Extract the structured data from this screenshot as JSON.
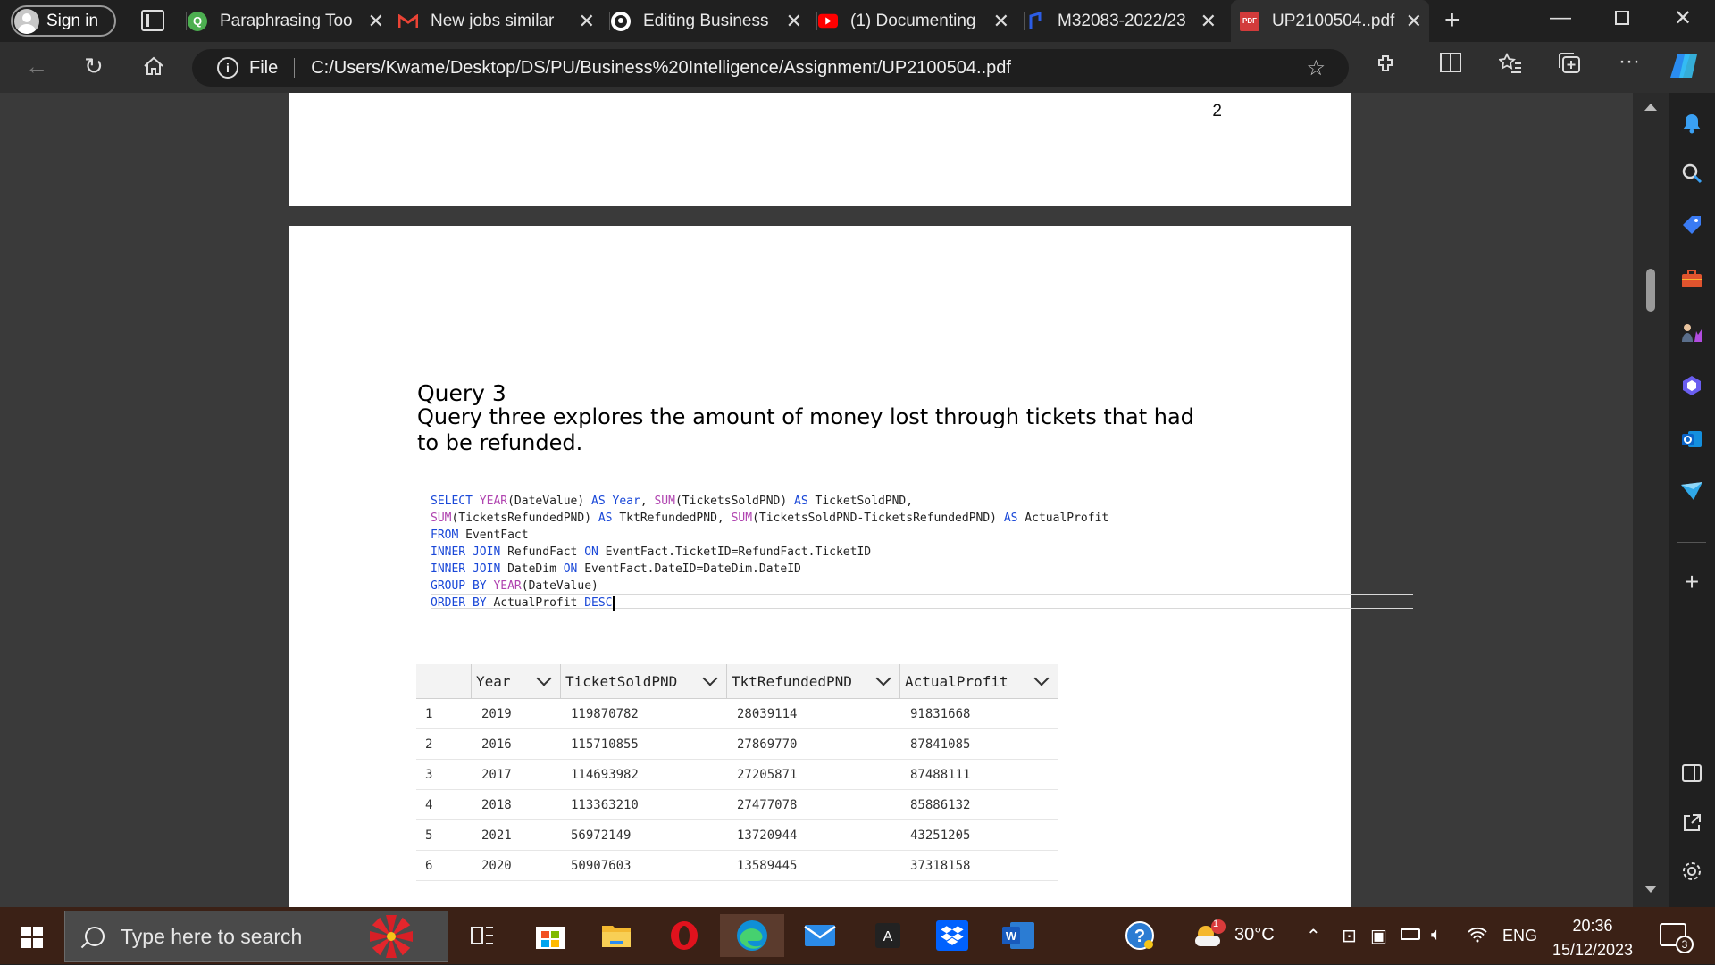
{
  "browser": {
    "profile_label": "Sign in",
    "tabs": [
      {
        "title": "Paraphrasing Too",
        "icon": "quillbot-icon",
        "closable": true
      },
      {
        "title": "New jobs similar",
        "icon": "gmail-icon",
        "closable": true
      },
      {
        "title": "Editing Business",
        "icon": "github-icon",
        "closable": true
      },
      {
        "title": "(1) Documenting",
        "icon": "youtube-icon",
        "closable": true
      },
      {
        "title": "M32083-2022/23",
        "icon": "moodle-icon",
        "closable": true
      },
      {
        "title": "UP2100504..pdf",
        "icon": "pdf-icon",
        "closable": true,
        "active": true
      }
    ],
    "address": {
      "scheme_label": "File",
      "url": "C:/Users/Kwame/Desktop/DS/PU/Business%20Intelligence/Assignment/UP2100504..pdf"
    }
  },
  "document": {
    "page_number_top": "2",
    "query_title": "Query 3",
    "query_description": "Query three explores the amount of money lost through tickets that had to be refunded.",
    "sql": [
      [
        [
          "kw",
          "SELECT "
        ],
        [
          "fn",
          "YEAR"
        ],
        [
          "t",
          "(DateValue) "
        ],
        [
          "kw",
          "AS"
        ],
        [
          "t",
          " "
        ],
        [
          "kw",
          "Year"
        ],
        [
          "t",
          ", "
        ],
        [
          "fn",
          "SUM"
        ],
        [
          "t",
          "(TicketsSoldPND) "
        ],
        [
          "kw",
          "AS"
        ],
        [
          "t",
          " TicketSoldPND,"
        ]
      ],
      [
        [
          "fn",
          "SUM"
        ],
        [
          "t",
          "(TicketsRefundedPND) "
        ],
        [
          "kw",
          "AS"
        ],
        [
          "t",
          " TktRefundedPND, "
        ],
        [
          "fn",
          "SUM"
        ],
        [
          "t",
          "(TicketsSoldPND-TicketsRefundedPND) "
        ],
        [
          "kw",
          "AS"
        ],
        [
          "t",
          " ActualProfit"
        ]
      ],
      [
        [
          "kw",
          "FROM"
        ],
        [
          "t",
          " EventFact"
        ]
      ],
      [
        [
          "kw",
          "INNER JOIN"
        ],
        [
          "t",
          " RefundFact "
        ],
        [
          "kw",
          "ON"
        ],
        [
          "t",
          " EventFact.TicketID=RefundFact.TicketID"
        ]
      ],
      [
        [
          "kw",
          "INNER JOIN"
        ],
        [
          "t",
          " DateDim "
        ],
        [
          "kw",
          "ON"
        ],
        [
          "t",
          " EventFact.DateID=DateDim.DateID"
        ]
      ],
      [
        [
          "kw",
          "GROUP BY"
        ],
        [
          "t",
          "  "
        ],
        [
          "fn",
          "YEAR"
        ],
        [
          "t",
          "(DateValue)"
        ]
      ],
      [
        [
          "kw",
          "ORDER BY"
        ],
        [
          "t",
          " ActualProfit "
        ],
        [
          "kw",
          "DESC"
        ]
      ]
    ],
    "results": {
      "columns": [
        "Year",
        "TicketSoldPND",
        "TktRefundedPND",
        "ActualProfit"
      ],
      "rows": [
        [
          "1",
          "2019",
          "119870782",
          "28039114",
          "91831668"
        ],
        [
          "2",
          "2016",
          "115710855",
          "27869770",
          "87841085"
        ],
        [
          "3",
          "2017",
          "114693982",
          "27205871",
          "87488111"
        ],
        [
          "4",
          "2018",
          "113363210",
          "27477078",
          "85886132"
        ],
        [
          "5",
          "2021",
          "56972149",
          "13720944",
          "43251205"
        ],
        [
          "6",
          "2020",
          "50907603",
          "13589445",
          "37318158"
        ]
      ]
    }
  },
  "taskbar": {
    "search_placeholder": "Type here to search",
    "weather_temp": "30°C",
    "weather_badge": "1",
    "language": "ENG",
    "time": "20:36",
    "date": "15/12/2023",
    "notification_count": "3"
  }
}
